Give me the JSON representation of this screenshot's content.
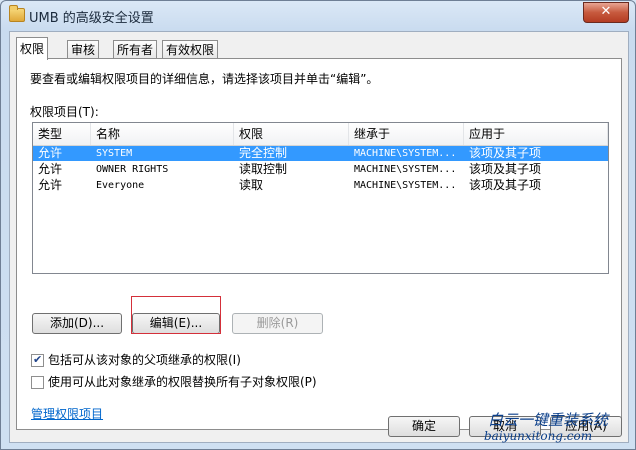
{
  "window": {
    "title": "UMB 的高级安全设置",
    "close_glyph": "✕"
  },
  "tabs": [
    {
      "label": "权限",
      "active": true
    },
    {
      "label": "审核",
      "active": false
    },
    {
      "label": "所有者",
      "active": false
    },
    {
      "label": "有效权限",
      "active": false
    }
  ],
  "panel": {
    "info_text": "要查看或编辑权限项目的详细信息，请选择该项目并单击“编辑”。",
    "list_label": "权限项目(T):",
    "columns": [
      "类型",
      "名称",
      "权限",
      "继承于",
      "应用于"
    ],
    "rows": [
      {
        "type": "允许",
        "name": "SYSTEM",
        "perm": "完全控制",
        "inherit": "MACHINE\\SYSTEM...",
        "apply": "该项及其子项",
        "selected": true
      },
      {
        "type": "允许",
        "name": "OWNER RIGHTS",
        "perm": "读取控制",
        "inherit": "MACHINE\\SYSTEM...",
        "apply": "该项及其子项",
        "selected": false
      },
      {
        "type": "允许",
        "name": "Everyone",
        "perm": "读取",
        "inherit": "MACHINE\\SYSTEM...",
        "apply": "该项及其子项",
        "selected": false
      }
    ],
    "buttons": {
      "add": "添加(D)...",
      "edit": "编辑(E)...",
      "remove": "删除(R)"
    },
    "checkboxes": [
      {
        "label": "包括可从该对象的父项继承的权限(I)",
        "checked": true,
        "check_glyph": "✔"
      },
      {
        "label": "使用可从此对象继承的权限替换所有子对象权限(P)",
        "checked": false
      }
    ],
    "link": "管理权限项目"
  },
  "footer": {
    "ok": "确定",
    "cancel": "取消",
    "apply": "应用(A)"
  },
  "watermark": {
    "text": "白云一键重装系统",
    "url": "baiyunxitong.com"
  },
  "colors": {
    "selection": "#3399ff",
    "link": "#0066cc",
    "highlight_box": "#d4303a"
  }
}
